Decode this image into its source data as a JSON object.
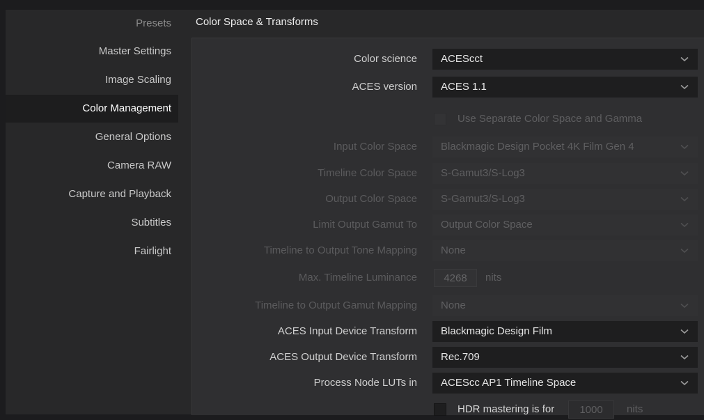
{
  "sidebar": {
    "items": [
      {
        "label": "Presets"
      },
      {
        "label": "Master Settings"
      },
      {
        "label": "Image Scaling"
      },
      {
        "label": "Color Management"
      },
      {
        "label": "General Options"
      },
      {
        "label": "Camera RAW"
      },
      {
        "label": "Capture and Playback"
      },
      {
        "label": "Subtitles"
      },
      {
        "label": "Fairlight"
      }
    ],
    "active_item": "Color Management"
  },
  "section": {
    "title": "Color Space & Transforms"
  },
  "fields": {
    "color_science": {
      "label": "Color science",
      "value": "ACEScct"
    },
    "aces_version": {
      "label": "ACES version",
      "value": "ACES 1.1"
    },
    "separate_color_space": {
      "label": "Use Separate Color Space and Gamma"
    },
    "input_color_space": {
      "label": "Input Color Space",
      "value": "Blackmagic Design Pocket 4K Film Gen 4"
    },
    "timeline_color_space": {
      "label": "Timeline Color Space",
      "value": "S-Gamut3/S-Log3"
    },
    "output_color_space": {
      "label": "Output Color Space",
      "value": "S-Gamut3/S-Log3"
    },
    "limit_output_gamut": {
      "label": "Limit Output Gamut To",
      "value": "Output Color Space"
    },
    "tone_mapping": {
      "label": "Timeline to Output Tone Mapping",
      "value": "None"
    },
    "max_luminance": {
      "label": "Max. Timeline Luminance",
      "value": "4268",
      "unit": "nits"
    },
    "gamut_mapping": {
      "label": "Timeline to Output Gamut Mapping",
      "value": "None"
    },
    "aces_idt": {
      "label": "ACES Input Device Transform",
      "value": "Blackmagic Design Film"
    },
    "aces_odt": {
      "label": "ACES Output Device Transform",
      "value": "Rec.709"
    },
    "process_node_luts": {
      "label": "Process Node LUTs in",
      "value": "ACEScc AP1 Timeline Space"
    },
    "hdr_mastering": {
      "label": "HDR mastering is for",
      "value": "1000",
      "unit": "nits"
    }
  },
  "colors": {
    "background": "#282829",
    "panel": "#2f2f31",
    "dropdown": "#1e1e1f",
    "active_item": "#1d1d1e",
    "disabled_text": "#5b5b5d"
  },
  "icons": {
    "dropdown": "chevron-down-icon",
    "checkbox": "checkbox-icon"
  }
}
